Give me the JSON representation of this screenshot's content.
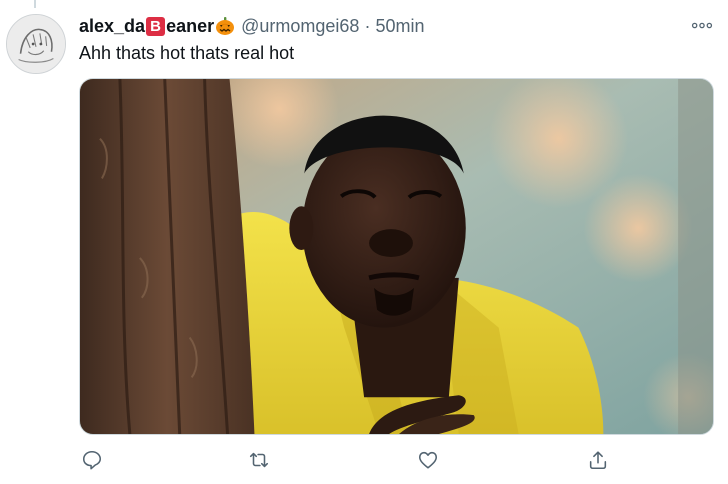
{
  "tweet": {
    "display_name_start": "alex_da",
    "display_name_badge": "B",
    "display_name_end": "eaner",
    "display_name_emoji": "pumpkin-emoji",
    "handle": "@urmomgei68",
    "separator": "·",
    "time": "50min",
    "text": "Ahh thats hot thats real hot"
  },
  "icons": {
    "more": "more-icon",
    "reply": "reply-icon",
    "retweet": "retweet-icon",
    "like": "like-icon",
    "share": "share-icon"
  },
  "colors": {
    "primary_text": "#0f1419",
    "secondary_text": "#536471",
    "badge": "#dd2e44",
    "border": "#cfd9de"
  }
}
